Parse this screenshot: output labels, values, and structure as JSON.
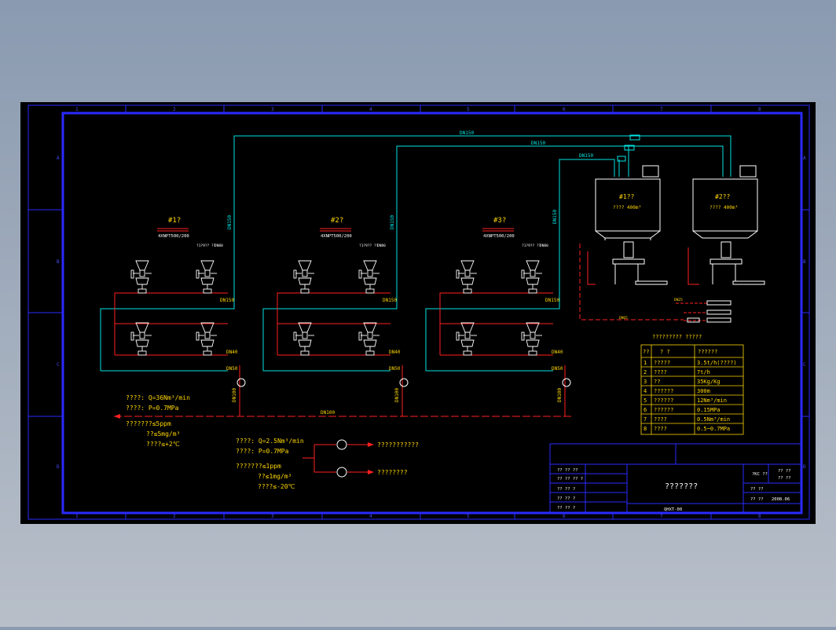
{
  "ruler": {
    "cols": [
      "1",
      "2",
      "3",
      "4",
      "5",
      "6",
      "7",
      "8"
    ],
    "rows": [
      "A",
      "B",
      "C",
      "D"
    ]
  },
  "pipes": {
    "main1": "DN150",
    "main2": "DN150",
    "main3": "DN150",
    "riser": "DN150",
    "branch": "DN150",
    "drop": "DN40",
    "drop2": "DN50",
    "vertical": "DN100",
    "header": "DN100",
    "dn25": "DN25",
    "dn65": "DN65",
    "small": "DN50"
  },
  "groups": [
    {
      "title": "#1?",
      "model": "4XNPT500/200",
      "tag1": "?1?9?? ??",
      "tag2": "DN80"
    },
    {
      "title": "#2?",
      "model": "4XNPT500/200",
      "tag1": "?1?9?? ??",
      "tag2": "DN80"
    },
    {
      "title": "#3?",
      "model": "4XNPT500/200",
      "tag1": "?1?9?? ??",
      "tag2": "DN80"
    }
  ],
  "silos": [
    {
      "title": "#1??",
      "cap": "???? 400m³"
    },
    {
      "title": "#2??",
      "cap": "???? 400m³"
    }
  ],
  "spec_air1": [
    "????: Q=36Nm³/min",
    "????: P=0.7MPa",
    "???????≤5ppm",
    "??≤5mg/m³",
    "????≤+2℃"
  ],
  "spec_air2": [
    "????: Q=2.5Nm³/min",
    "????: P=0.7MPa",
    "???????≤1ppm",
    "??≤1mg/m³",
    "????≤-20℃"
  ],
  "outlets": [
    "???????????",
    "????????"
  ],
  "table": {
    "title": "?????????   ?????",
    "headers": [
      "??",
      "?   ?",
      "??????"
    ],
    "rows": [
      [
        "1",
        "?????",
        "3.5t/h(????)"
      ],
      [
        "2",
        "????",
        "7t/h"
      ],
      [
        "3",
        "??",
        "35Kg/Kg"
      ],
      [
        "4",
        "??????",
        "300m"
      ],
      [
        "5",
        "??????",
        "12Nm³/min"
      ],
      [
        "6",
        "??????",
        "0.15MPa"
      ],
      [
        "7",
        "????",
        "0.5Nm³/min"
      ],
      [
        "8",
        "????",
        "0.5~0.7MPa"
      ]
    ]
  },
  "titleblock": {
    "drawing_title": "???????",
    "left_rows": [
      "?? ?? ??",
      "?? ?? ?? ?",
      "?? ?? ?",
      "?? ?? ?",
      "?? ?? ?"
    ],
    "mid_label": "QHXT-00",
    "r1a": "?KC ??",
    "r1b": "??   ??",
    "r1c": "?? ??",
    "scale_label": "?? ??",
    "date_label": "?? ??",
    "date": "2008.06"
  },
  "colors": {
    "background": "#000000",
    "frame": "#1a1aff",
    "conveying_line": "#00e5e5",
    "air_line": "#ff2020",
    "equipment": "#ffffff",
    "text": "#ffd700"
  }
}
